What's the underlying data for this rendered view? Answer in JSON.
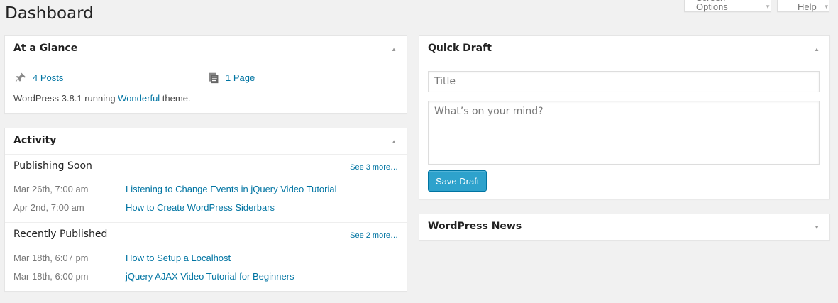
{
  "page": {
    "title": "Dashboard"
  },
  "screen_meta": {
    "screen_options": "Screen Options",
    "help": "Help"
  },
  "glance": {
    "title": "At a Glance",
    "posts": "4 Posts",
    "pages": "1 Page",
    "version_prefix": "WordPress 3.8.1 running ",
    "theme": "Wonderful",
    "version_suffix": " theme."
  },
  "activity": {
    "title": "Activity",
    "publishing_soon": {
      "heading": "Publishing Soon",
      "see_more": "See 3 more…",
      "items": [
        {
          "date": "Mar 26th, 7:00 am",
          "title": "Listening to Change Events in jQuery Video Tutorial"
        },
        {
          "date": "Apr 2nd, 7:00 am",
          "title": "How to Create WordPress Siderbars"
        }
      ]
    },
    "recently_published": {
      "heading": "Recently Published",
      "see_more": "See 2 more…",
      "items": [
        {
          "date": "Mar 18th, 6:07 pm",
          "title": "How to Setup a Localhost"
        },
        {
          "date": "Mar 18th, 6:00 pm",
          "title": "jQuery AJAX Video Tutorial for Beginners"
        }
      ]
    }
  },
  "quick_draft": {
    "title": "Quick Draft",
    "title_placeholder": "Title",
    "content_placeholder": "What’s on your mind?",
    "save_label": "Save Draft"
  },
  "news": {
    "title": "WordPress News"
  },
  "icons": {
    "toggle_up": "▲",
    "toggle_down": "▼",
    "posts": "pin-icon",
    "pages": "pages-icon"
  },
  "colors": {
    "accent": "#0074a2",
    "button": "#2ea2cc",
    "background": "#f1f1f1"
  }
}
